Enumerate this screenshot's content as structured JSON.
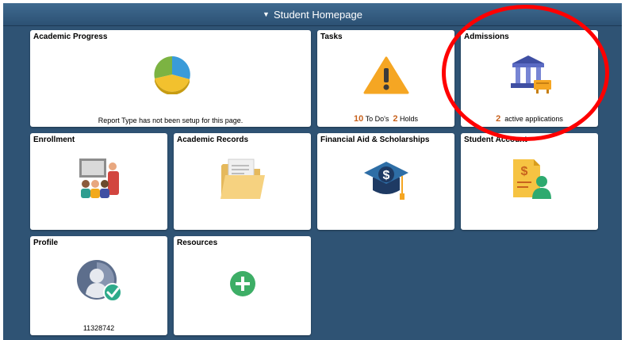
{
  "banner": {
    "caret": "▼",
    "title": "Student Homepage"
  },
  "tiles": {
    "academic_progress": {
      "title": "Academic Progress",
      "icon": "pie-chart-icon",
      "message": "Report Type has not been setup for this page."
    },
    "tasks": {
      "title": "Tasks",
      "icon": "warning-icon",
      "todo_count": "10",
      "todo_label": "To Do's",
      "holds_count": "2",
      "holds_label": "Holds"
    },
    "admissions": {
      "title": "Admissions",
      "icon": "institution-icon",
      "count": "2",
      "label": "active applications"
    },
    "enrollment": {
      "title": "Enrollment",
      "icon": "classroom-icon"
    },
    "academic_records": {
      "title": "Academic Records",
      "icon": "folder-icon"
    },
    "financial_aid": {
      "title": "Financial Aid & Scholarships",
      "icon": "graduation-cap-dollar-icon"
    },
    "student_account": {
      "title": "Student Account",
      "icon": "account-bill-icon"
    },
    "profile": {
      "title": "Profile",
      "icon": "user-verified-icon",
      "id": "11328742"
    },
    "resources": {
      "title": "Resources",
      "icon": "add-circle-icon"
    }
  },
  "annotation": {
    "color": "#ff0000"
  },
  "colors": {
    "background": "#2f5374",
    "accent_number": "#c8621d"
  }
}
